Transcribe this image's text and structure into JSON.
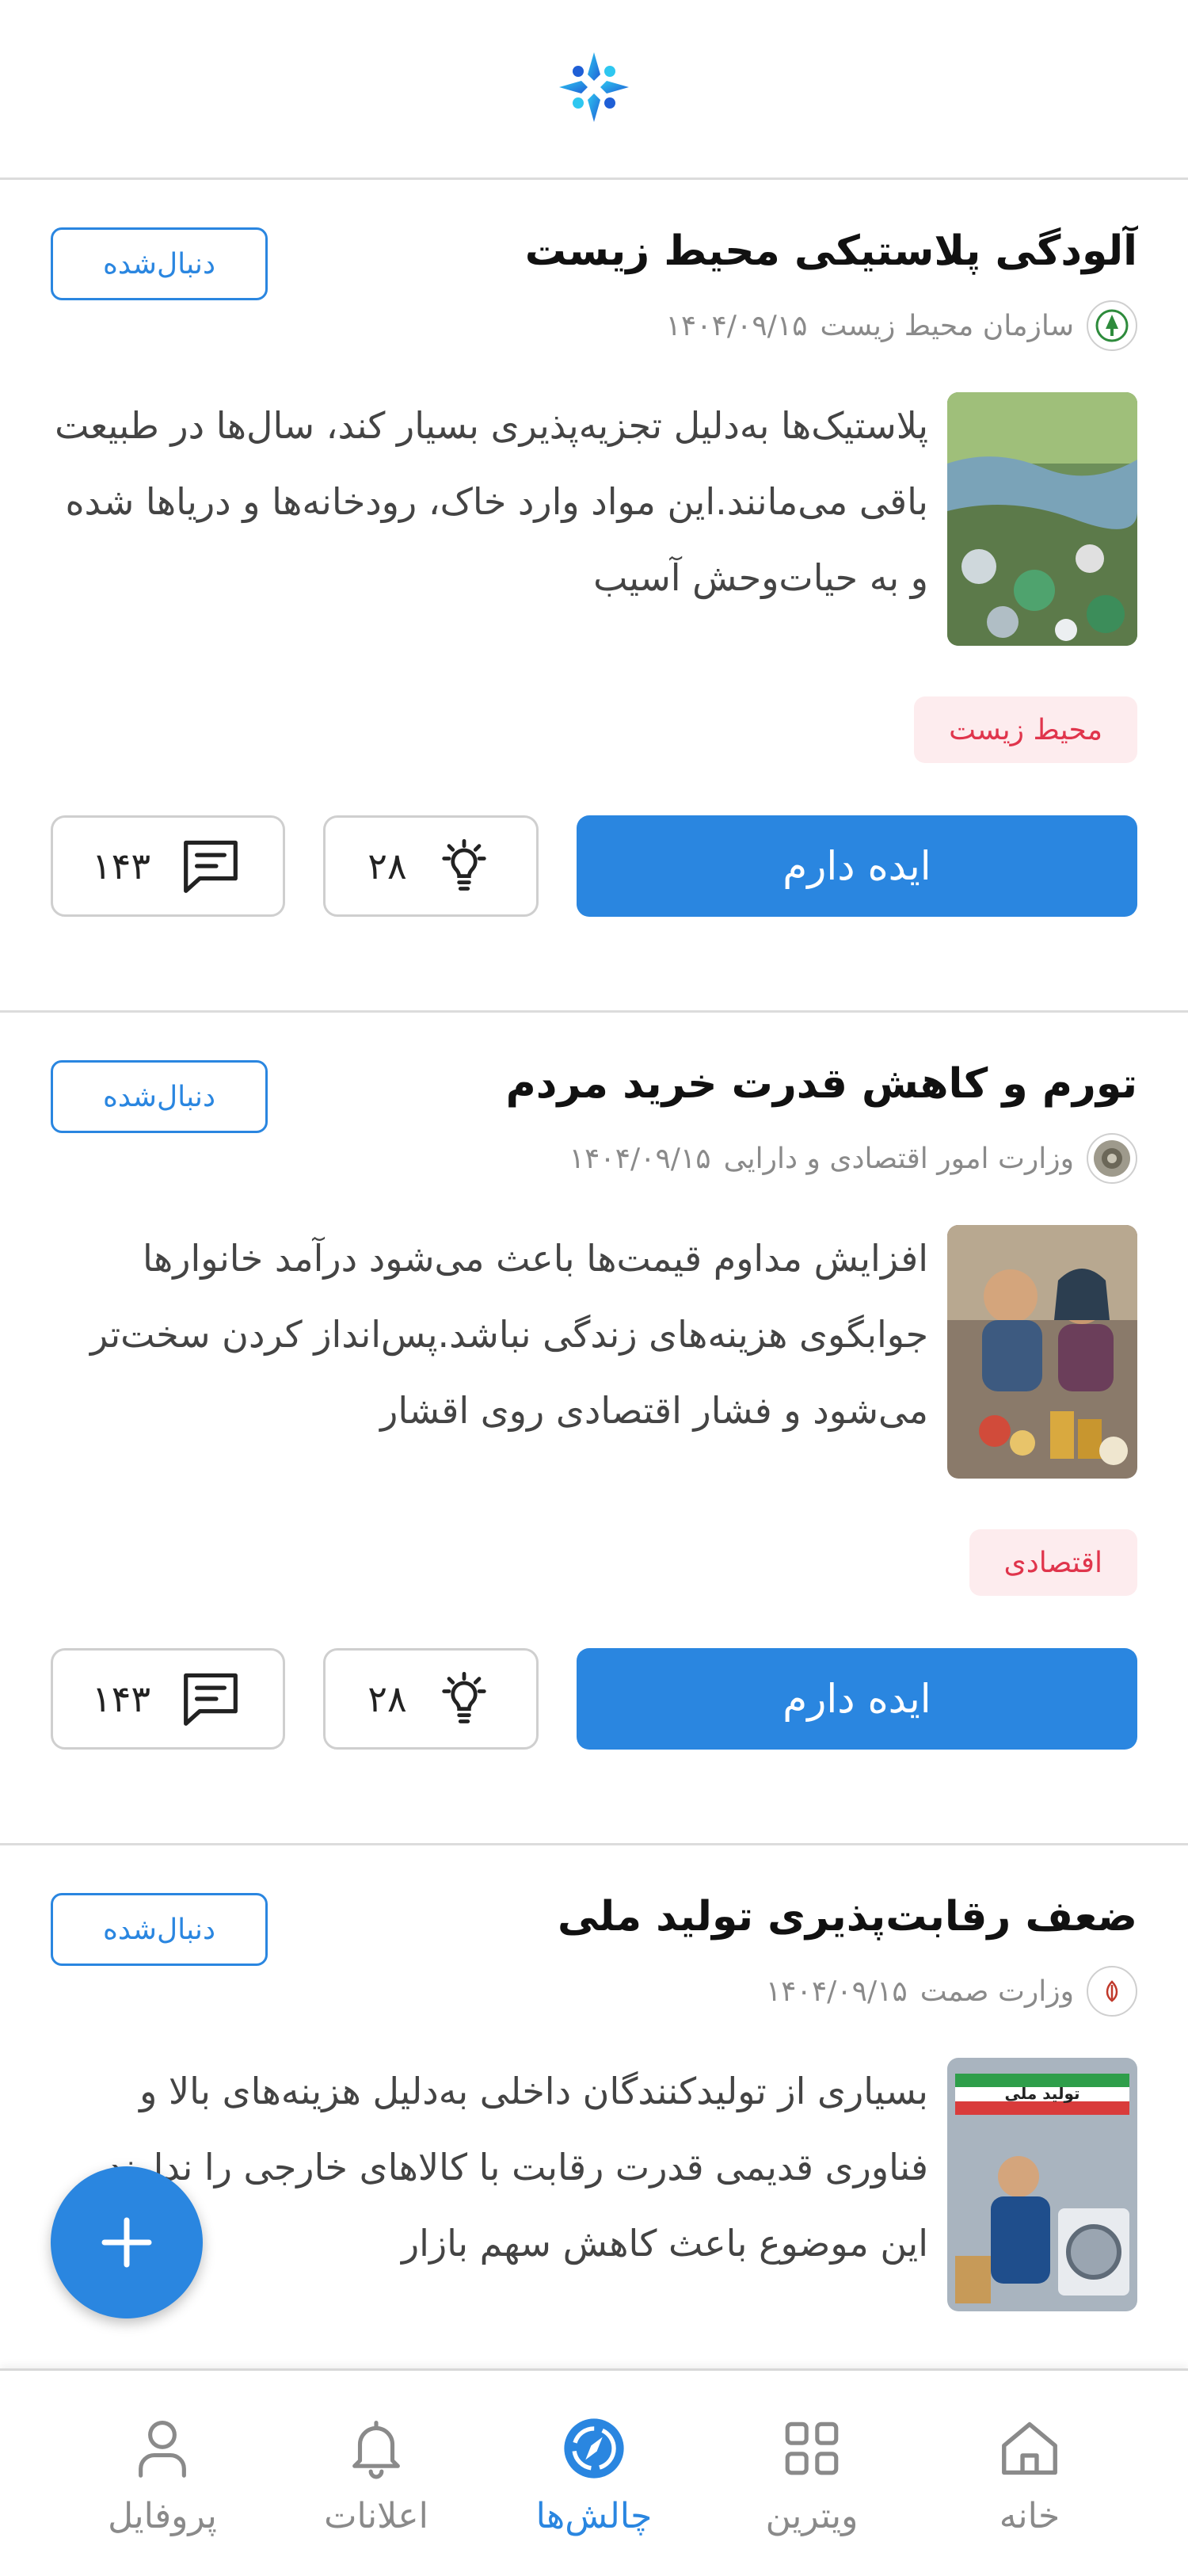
{
  "colors": {
    "accent": "#2a86e0",
    "tag_bg": "#fdecee",
    "tag_text": "#e0354c",
    "muted": "#8a8a8a"
  },
  "icons": {
    "header_logo": "app-logo-icon",
    "ideas": "lightbulb-icon",
    "comments": "comment-icon",
    "fab": "plus-icon"
  },
  "cards": [
    {
      "title": "آلودگی پلاستیکی محیط زیست",
      "org": "سازمان محیط زیست",
      "date": "۱۴۰۴/۰۹/۱۵",
      "description": "پلاستیک‌ها به‌دلیل تجزیه‌پذیری بسیار کند، سال‌ها در طبیعت باقی می‌مانند.این مواد وارد خاک، رودخانه‌ها و دریاها شده و به حیات‌وحش آسیب",
      "tag": "محیط زیست",
      "follow_label": "دنبال‌شده",
      "idea_label": "ایده دارم",
      "ideas_count": "۲۸",
      "comments_count": "۱۴۳"
    },
    {
      "title": "تورم و کاهش قدرت خرید مردم",
      "org": "وزارت امور اقتصادی و دارایی",
      "date": "۱۴۰۴/۰۹/۱۵",
      "description": "افزایش مداوم قیمت‌ها باعث می‌شود درآمد خانوارها جوابگوی هزینه‌های زندگی نباشد.پس‌انداز کردن سخت‌تر می‌شود و فشار اقتصادی روی اقشار",
      "tag": "اقتصادی",
      "follow_label": "دنبال‌شده",
      "idea_label": "ایده دارم",
      "ideas_count": "۲۸",
      "comments_count": "۱۴۳"
    },
    {
      "title": "ضعف رقابت‌پذیری تولید ملی",
      "org": "وزارت صمت",
      "date": "۱۴۰۴/۰۹/۱۵",
      "description": "بسیاری از تولیدکنندگان داخلی به‌دلیل هزینه‌های بالا و فناوری قدیمی قدرت رقابت با کالاهای خارجی را ندارند. این موضوع باعث کاهش سهم بازار",
      "image_text": "تولید ملی",
      "follow_label": "دنبال‌شده"
    }
  ],
  "nav": {
    "home": "خانه",
    "showcase": "ویترین",
    "challenges": "چالش‌ها",
    "notifications": "اعلانات",
    "profile": "پروفایل",
    "active": "challenges"
  }
}
